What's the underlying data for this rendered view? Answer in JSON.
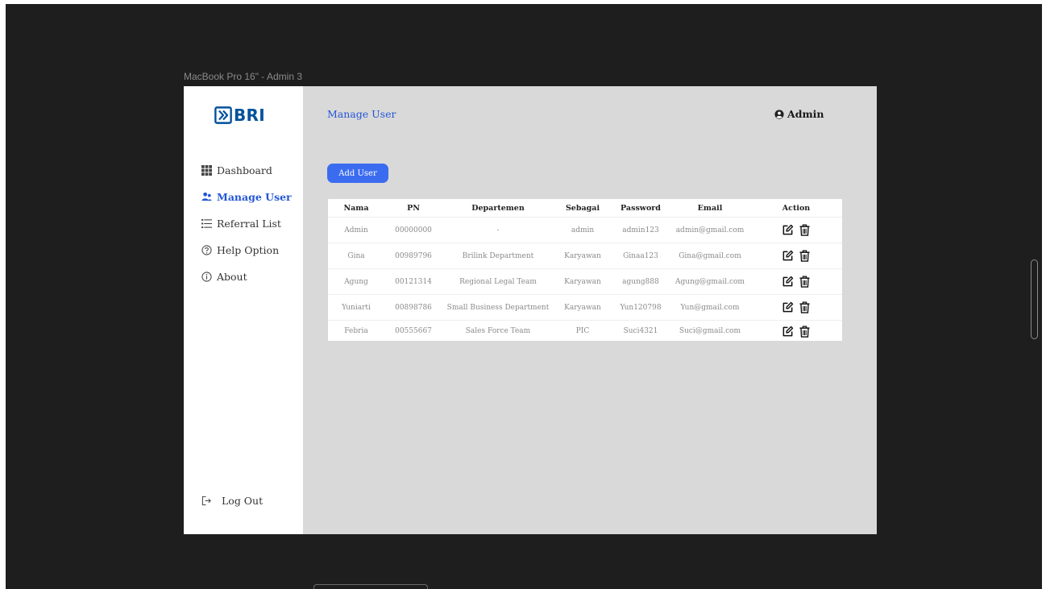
{
  "frame_label": "MacBook Pro 16\" - Admin 3",
  "brand": {
    "name": "BRI",
    "color": "#00529c"
  },
  "sidebar": {
    "items": [
      {
        "label": "Dashboard",
        "icon": "grid-icon",
        "active": false
      },
      {
        "label": "Manage User",
        "icon": "users-icon",
        "active": true
      },
      {
        "label": "Referral List",
        "icon": "list-icon",
        "active": false
      },
      {
        "label": "Help Option",
        "icon": "help-circle-icon",
        "active": false
      },
      {
        "label": "About",
        "icon": "info-circle-icon",
        "active": false
      }
    ],
    "logout_label": "Log Out"
  },
  "header": {
    "title": "Manage User",
    "user_label": "Admin"
  },
  "toolbar": {
    "add_label": "Add User"
  },
  "table": {
    "columns": [
      "Nama",
      "PN",
      "Departemen",
      "Sebagai",
      "Password",
      "Email",
      "Action"
    ],
    "rows": [
      {
        "nama": "Admin",
        "pn": "00000000",
        "departemen": "-",
        "sebagai": "admin",
        "password": "admin123",
        "email": "admin@gmail.com"
      },
      {
        "nama": "Gina",
        "pn": "00989796",
        "departemen": "Brilink Department",
        "sebagai": "Karyawan",
        "password": "Ginaa123",
        "email": "Gina@gmail.com"
      },
      {
        "nama": "Agung",
        "pn": "00121314",
        "departemen": "Regional Legal Team",
        "sebagai": "Karyawan",
        "password": "agung888",
        "email": "Agung@gmail.com"
      },
      {
        "nama": "Yuniarti",
        "pn": "00898786",
        "departemen": "Small Business Department",
        "sebagai": "Karyawan",
        "password": "Yun120798",
        "email": "Yun@gmail.com"
      },
      {
        "nama": "Febria",
        "pn": "00555667",
        "departemen": "Sales Force Team",
        "sebagai": "PIC",
        "password": "Suci4321",
        "email": "Suci@gmail.com"
      }
    ]
  },
  "colors": {
    "accent": "#3b6cf0",
    "active_nav": "#2356d6",
    "canvas": "#1e1e1e",
    "content_bg": "#d9d9d9"
  }
}
